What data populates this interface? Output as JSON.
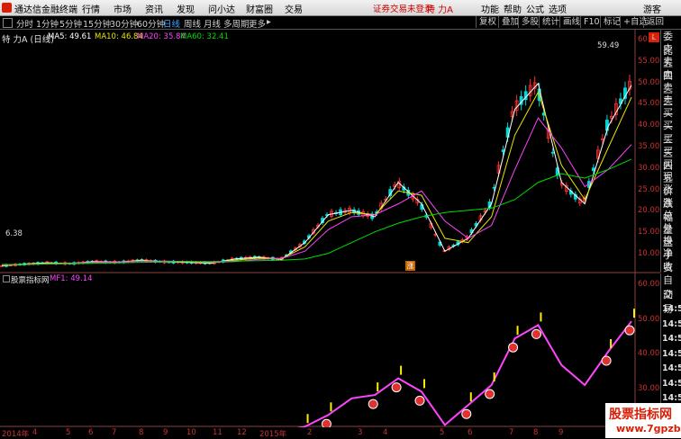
{
  "menu": {
    "app_name": "通达信金融终端",
    "items": [
      "行情",
      "市场",
      "资讯",
      "发现",
      "问小达",
      "财富圈",
      "交易"
    ],
    "warning": "证券交易未登录",
    "stock_name": "特 力A",
    "right_items": [
      "功能",
      "帮助",
      "公式",
      "选项"
    ],
    "guest": "游客"
  },
  "periods": {
    "items": [
      "分时",
      "1分钟",
      "5分钟",
      "15分钟",
      "30分钟",
      "60分钟",
      "日线",
      "周线",
      "月线",
      "多周期",
      "更多"
    ],
    "selected": "日线",
    "more_arrow": "▸"
  },
  "toolbar_right": [
    "复权",
    "叠加",
    "多股",
    "统计",
    "画线",
    "F10",
    "标记",
    "+自选",
    "返回"
  ],
  "main_chart": {
    "title": "特 力A (日线)",
    "ma": [
      {
        "label": "MA5: 49.61",
        "color": "#ffffff"
      },
      {
        "label": "MA10: 46.84",
        "color": "#e8e800"
      },
      {
        "label": "MA20: 35.84",
        "color": "#ff44ff"
      },
      {
        "label": "MA60: 32.41",
        "color": "#00dd00"
      }
    ],
    "high_marker": "59.49",
    "low_marker": "6.38",
    "event_marker": "涨",
    "y_ticks": [
      "60.00",
      "55.00",
      "50.00",
      "45.00",
      "40.00",
      "35.00",
      "30.00",
      "25.00",
      "20.00",
      "15.00",
      "10.00"
    ],
    "corner_badge": "L"
  },
  "chart_data": [
    {
      "type": "line",
      "title": "特 力A (日线)",
      "series": [
        {
          "name": "MA5",
          "values": [
            7.6,
            8.0,
            8.3,
            8.1,
            8.6,
            8.4,
            8.9,
            8.5,
            8.4,
            8.2,
            9.2,
            9.6,
            9.1,
            13.0,
            19.5,
            20.5,
            19.0,
            27.0,
            22.0,
            11.0,
            14.0,
            22.0,
            44.0,
            50.0,
            27.0,
            22.0,
            40.0,
            49.6
          ]
        },
        {
          "name": "MA10",
          "values": [
            7.7,
            7.9,
            8.2,
            8.2,
            8.5,
            8.5,
            8.8,
            8.6,
            8.5,
            8.3,
            8.9,
            9.4,
            9.3,
            12.0,
            18.0,
            20.0,
            19.5,
            25.0,
            24.0,
            14.0,
            13.0,
            19.0,
            38.0,
            48.0,
            31.0,
            23.0,
            35.0,
            46.8
          ]
        },
        {
          "name": "MA20",
          "values": [
            7.8,
            7.9,
            8.1,
            8.2,
            8.4,
            8.5,
            8.7,
            8.7,
            8.6,
            8.4,
            8.6,
            9.1,
            9.3,
            11.0,
            16.0,
            19.0,
            19.5,
            22.0,
            25.0,
            18.0,
            14.0,
            17.0,
            30.0,
            42.0,
            35.0,
            26.0,
            30.0,
            35.8
          ]
        },
        {
          "name": "MA60",
          "values": [
            7.9,
            7.9,
            8.0,
            8.1,
            8.2,
            8.3,
            8.4,
            8.5,
            8.6,
            8.6,
            8.7,
            8.8,
            8.9,
            9.2,
            10.5,
            13.0,
            15.5,
            17.5,
            19.0,
            20.0,
            20.5,
            21.0,
            23.0,
            27.0,
            29.0,
            28.0,
            30.0,
            32.4
          ]
        }
      ]
    },
    {
      "type": "line",
      "title": "股票指标网",
      "series": [
        {
          "name": "MF1",
          "values": [
            14.5,
            15.0,
            14.8,
            14.6,
            15.2,
            15.5,
            15.3,
            15.8,
            15.6,
            15.2,
            15.0,
            15.4,
            16.0,
            17.5,
            21.0,
            26.0,
            27.0,
            32.0,
            28.0,
            18.0,
            24.0,
            30.0,
            44.0,
            48.0,
            36.0,
            30.0,
            40.0,
            49.14
          ]
        }
      ]
    }
  ],
  "indicator": {
    "title": "股票指标网",
    "mf_label": "MF1: 49.14",
    "y_ticks": [
      "60.00",
      "50.00",
      "40.00",
      "30.00",
      "20.00"
    ]
  },
  "x_axis": [
    "2014年",
    "4",
    "5",
    "6",
    "7",
    "8",
    "9",
    "10",
    "11",
    "12",
    "2015年",
    "2",
    "3",
    "4",
    "5",
    "6",
    "7",
    "8",
    "9"
  ],
  "quote_panel": [
    "委比",
    "卖五",
    "卖四",
    "卖三",
    "卖二",
    "卖一",
    "买一",
    "买二",
    "买三",
    "买四",
    "买五",
    "现价",
    "涨跌",
    "涨幅",
    "总量",
    "外盘",
    "换手",
    "净资",
    "收益"
  ],
  "right_panel": {
    "label1": "自动",
    "label2": "交易",
    "times": [
      "14:50",
      "14:50",
      "14:50",
      "14:50",
      "14:50",
      "14:50",
      "14:50",
      "14:50"
    ]
  },
  "watermark": {
    "line1": "股票指标网",
    "line2": "www.7gpzb.com"
  }
}
